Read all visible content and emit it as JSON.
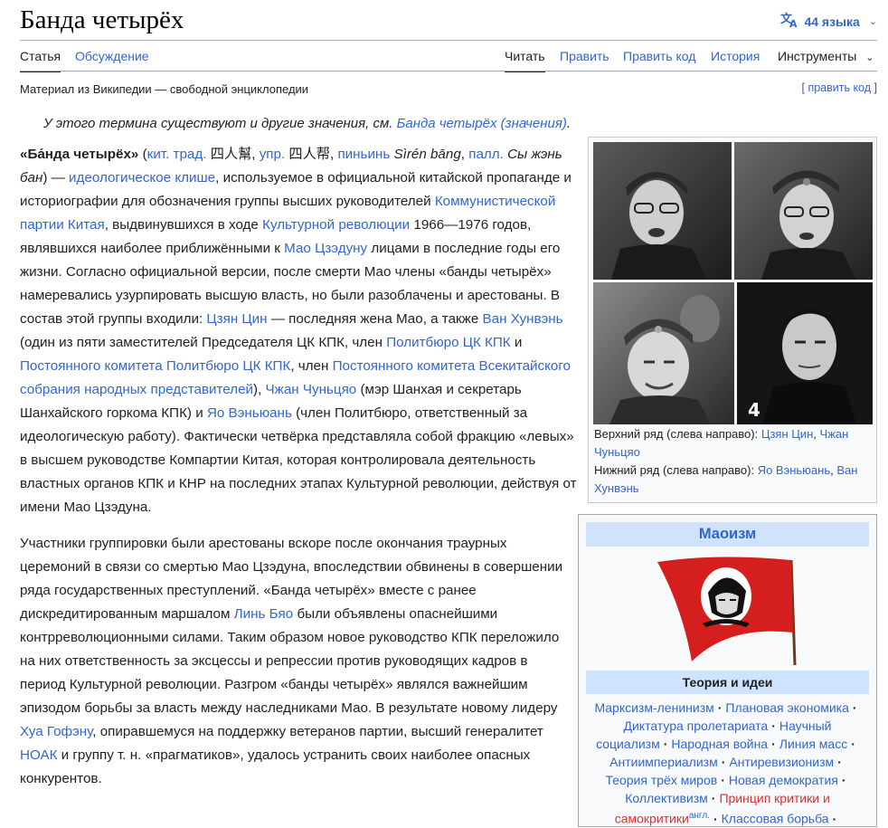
{
  "page": {
    "title": "Банда четырёх",
    "languages": "44 языка"
  },
  "tabs": {
    "article": "Статья",
    "talk": "Обсуждение",
    "read": "Читать",
    "edit": "Править",
    "edit_source": "Править код",
    "history": "История",
    "tools": "Инструменты"
  },
  "tagline": "Материал из Википедии — свободной энциклопедии",
  "edit_code_link": {
    "open": "[",
    "label": "править код",
    "close": "]"
  },
  "hatnote": {
    "text": "У этого термина существуют и другие значения, см.",
    "link": "Банда четырёх (значения)",
    "end": "."
  },
  "para1": {
    "term": "«Ба́нда четырёх»",
    "t1": " (",
    "l_kit": "кит. трад.",
    "hz_trad": "四人幫",
    "t2": ", ",
    "l_upr": "упр.",
    "hz_simp": "四人帮",
    "t3": ", ",
    "l_pinyin": "пиньинь",
    "pinyin": "Sìrén bāng",
    "t4": ", ",
    "l_pall": "палл.",
    "pall": "Сы жэнь бан",
    "t5": ") — ",
    "l_cliche": "идеологическое клише",
    "t6": ", используемое в официальной китайской пропаганде и историографии для обозначения группы высших руководителей ",
    "l_kpk": "Коммунистической партии Китая",
    "t7": ", выдвинувшихся в ходе ",
    "l_rev": "Культурной революции",
    "t8": " 1966—1976 годов, являвшихся наиболее приближёнными к ",
    "l_mao": "Мао Цзэдуну",
    "t9": " лицами в последние годы его жизни. Согласно официальной версии, после смерти Мао члены «банды четырёх» намеревались узурпировать высшую власть, но были разоблачены и арестованы. В состав этой группы входили: ",
    "l_jiang": "Цзян Цин",
    "t10": " — последняя жена Мао, а также ",
    "l_wang": "Ван Хунвэнь",
    "t11": " (один из пяти заместителей Председателя ЦК КПК, член ",
    "l_politburo": "Политбюро ЦК КПК",
    "t12": " и ",
    "l_standing": "Постоянного комитета Политбюро ЦК КПК",
    "t13": ", член ",
    "l_npc": "Постоянного комитета Всекитайского собрания народных представителей",
    "t14": "), ",
    "l_zhang": "Чжан Чуньцяо",
    "t15": " (мэр Шанхая и секретарь Шанхайского горкома КПК) и ",
    "l_yao": "Яо Вэньюань",
    "t16": " (член Политбюро, ответственный за идеологическую работу). Фактически четвёрка представляла собой фракцию «левых» в высшем руководстве Компартии Китая, которая контролировала деятельность властных органов КПК и КНР на последних этапах Культурной революции, действуя от имени Мао Цзэдуна."
  },
  "para2": {
    "t1": "Участники группировки были арестованы вскоре после окончания траурных церемоний в связи со смертью Мао Цзэдуна, впоследствии обвинены в совершении ряда государственных преступлений. «Банда четырёх» вместе с ранее дискредитированным маршалом ",
    "l_lin": "Линь Бяо",
    "t2": " были объявлены опаснейшими контрреволюционными силами. Таким образом новое руководство КПК переложило на них ответственность за эксцессы и репрессии против руководящих кадров в период Культурной революции. Разгром «банды четырёх» являлся важнейшим эпизодом борьбы за власть между наследниками Мао. В результате новому лидеру ",
    "l_hua": "Хуа Гофэну",
    "t3": ", опиравшемуся на поддержку ветеранов партии, высший генералитет ",
    "l_nodak": "НОАК",
    "t4": " и группу т. н. «прагматиков», удалось устранить своих наиболее опасных конкурентов."
  },
  "image": {
    "number_label": "4",
    "cap_top": "Верхний ряд (слева направо): ",
    "l_jiang": "Цзян Цин",
    "cap_comma": ", ",
    "l_zhang": "Чжан Чуньцяо",
    "cap_bottom": "Нижний ряд (слева направо): ",
    "l_yao": "Яо Вэньюань",
    "l_wang": "Ван Хунвэнь"
  },
  "navbox": {
    "title": "Маоизм",
    "subtitle": "Теория и идеи",
    "items": [
      "Марксизм-ленинизм",
      "Плановая экономика",
      "Диктатура пролетариата",
      "Научный социализм",
      "Народная война",
      "Линия масс",
      "Антиимпериализм",
      "Антиревизионизм",
      "Теория трёх миров",
      "Новая демократия",
      "Коллективизм",
      "Принцип критики и самокритики",
      "англ.",
      "Классовая борьба"
    ]
  },
  "colors": {
    "link": "#3366cc",
    "redlink": "#d73333",
    "nav_header": "#cfe3ff",
    "flag_red": "#d51e1e"
  }
}
